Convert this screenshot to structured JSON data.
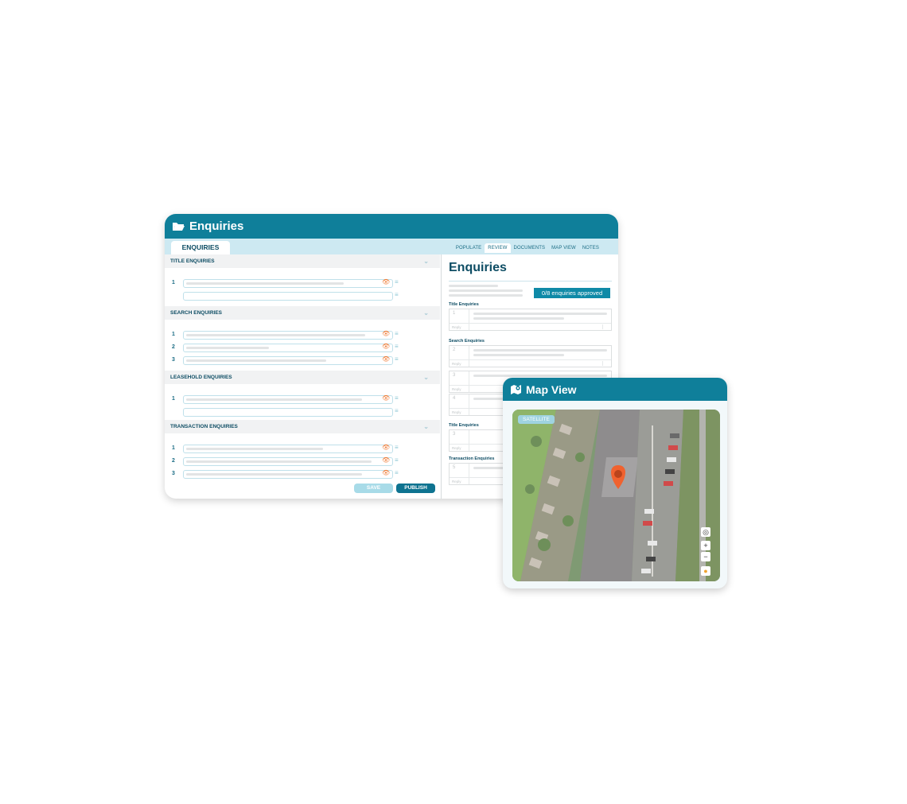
{
  "main_window": {
    "title": "Enquiries",
    "left_tab": "ENQUIRIES",
    "right_tabs": [
      {
        "label": "POPULATE",
        "active": false
      },
      {
        "label": "REVIEW",
        "active": true
      },
      {
        "label": "DOCUMENTS",
        "active": false
      },
      {
        "label": "MAP VIEW",
        "active": false
      },
      {
        "label": "NOTES",
        "active": false
      }
    ],
    "sections": [
      {
        "title": "TITLE ENQUIRIES",
        "rows": [
          "1",
          ""
        ]
      },
      {
        "title": "SEARCH ENQUIRIES",
        "rows": [
          "1",
          "2",
          "3"
        ]
      },
      {
        "title": "LEASEHOLD ENQUIRIES",
        "rows": [
          "1",
          ""
        ]
      },
      {
        "title": "TRANSACTION ENQUIRIES",
        "rows": [
          "1",
          "2",
          "3"
        ]
      }
    ],
    "save_label": "SAVE",
    "publish_label": "PUBLISH"
  },
  "review": {
    "title": "Enquiries",
    "badge": "0/8 enquiries approved",
    "groups": [
      {
        "title": "Title Enquiries",
        "items": [
          "1"
        ]
      },
      {
        "title": "Search Enquiries",
        "items": [
          "2",
          "3",
          "4"
        ]
      },
      {
        "title": "Title Enquiries",
        "items": [
          "3"
        ]
      },
      {
        "title": "Transaction Enquiries",
        "items": [
          "5"
        ]
      }
    ],
    "reply_label": "Reply"
  },
  "map_view": {
    "title": "Map View",
    "layer_label": "SATELLITE",
    "zoom_in": "+",
    "zoom_out": "−"
  },
  "colors": {
    "header": "#0f7f9a",
    "accent_orange": "#f07a33",
    "tab_bar": "#cde9f2"
  }
}
